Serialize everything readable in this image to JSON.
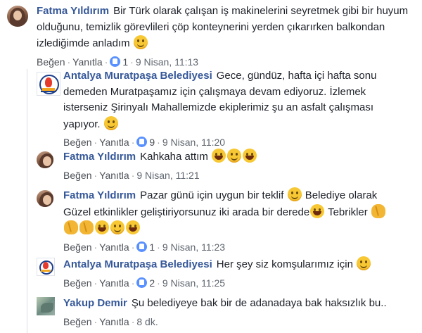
{
  "comments": [
    {
      "author": "Fatma Yıldırım",
      "text": "Bir Türk olarak çalışan iş makinelerini seyretmek gibi bir huyum olduğunu, temizlik görevlileri çöp konteynerini yerden çıkarırken balkondan izlediğimde anladım",
      "like_label": "Beğen",
      "reply_label": "Yanıtla",
      "reaction_count": "1",
      "timestamp": "9 Nisan, 11:13"
    },
    {
      "author": "Antalya Muratpaşa Belediyesi",
      "text": "Gece, gündüz, hafta içi hafta sonu demeden Muratpaşamız için çalışmaya devam ediyoruz. İzlemek isterseniz Şirinyalı Mahallemizde ekiplerimiz şu an asfalt çalışması yapıyor.",
      "like_label": "Beğen",
      "reply_label": "Yanıtla",
      "reaction_count": "9",
      "timestamp": "9 Nisan, 11:20"
    },
    {
      "author": "Fatma Yıldırım",
      "text": "Kahkaha attım",
      "like_label": "Beğen",
      "reply_label": "Yanıtla",
      "timestamp": "9 Nisan, 11:21"
    },
    {
      "author": "Fatma Yıldırım",
      "text_1": "Pazar günü için uygun bir teklif",
      "text_2": "Belediye olarak Güzel etkinlikler geliştiriyorsunuz iki arada bir derede",
      "text_3": "Tebrikler",
      "like_label": "Beğen",
      "reply_label": "Yanıtla",
      "reaction_count": "1",
      "timestamp": "9 Nisan, 11:23"
    },
    {
      "author": "Antalya Muratpaşa Belediyesi",
      "text": "Her şey siz komşularımız için",
      "like_label": "Beğen",
      "reply_label": "Yanıtla",
      "reaction_count": "2",
      "timestamp": "9 Nisan, 11:25"
    },
    {
      "author": "Yakup Demir",
      "text": "Şu belediyeye bak bir de adanadaya bak haksızlık bu..",
      "like_label": "Beğen",
      "reply_label": "Yanıtla",
      "timestamp": "8 dk."
    }
  ],
  "icons": {
    "reaction": "like-icon",
    "emoji_smile": "smile-emoji-icon",
    "emoji_laugh": "laugh-emoji-icon",
    "emoji_clap": "clap-emoji-icon"
  },
  "colors": {
    "author": "#365899",
    "meta": "#606770",
    "reaction_blue": "#5890ff",
    "divider": "#dddfe2"
  }
}
